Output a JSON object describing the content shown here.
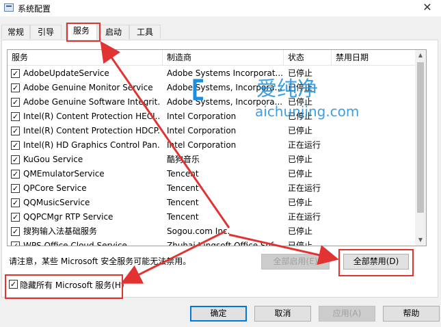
{
  "window": {
    "title": "系统配置",
    "close": "✕"
  },
  "tabs": [
    {
      "label": "常规"
    },
    {
      "label": "引导"
    },
    {
      "label": "服务"
    },
    {
      "label": "启动"
    },
    {
      "label": "工具"
    }
  ],
  "columns": [
    "服务",
    "制造商",
    "状态",
    "禁用日期"
  ],
  "services": [
    {
      "name": "AdobeUpdateService",
      "vendor": "Adobe Systems Incorporat...",
      "status": "已停止"
    },
    {
      "name": "Adobe Genuine Monitor Service",
      "vendor": "Adobe Systems, Incorpora...",
      "status": "已停止"
    },
    {
      "name": "Adobe Genuine Software Integrit...",
      "vendor": "Adobe Systems, Incorpora...",
      "status": "已停止"
    },
    {
      "name": "Intel(R) Content Protection HECI...",
      "vendor": "Intel Corporation",
      "status": "已停止"
    },
    {
      "name": "Intel(R) Content Protection HDCP...",
      "vendor": "Intel Corporation",
      "status": "已停止"
    },
    {
      "name": "Intel(R) HD Graphics Control Pan...",
      "vendor": "Intel Corporation",
      "status": "正在运行"
    },
    {
      "name": "KuGou Service",
      "vendor": "酷狗音乐",
      "status": "已停止"
    },
    {
      "name": "QMEmulatorService",
      "vendor": "Tencent",
      "status": "已停止"
    },
    {
      "name": "QPCore Service",
      "vendor": "Tencent",
      "status": "正在运行"
    },
    {
      "name": "QQMusicService",
      "vendor": "Tencent",
      "status": "已停止"
    },
    {
      "name": "QQPCMgr RTP Service",
      "vendor": "Tencent",
      "status": "正在运行"
    },
    {
      "name": "搜狗输入法基础服务",
      "vendor": "Sogou.com Inc.",
      "status": "已停止"
    },
    {
      "name": "WPS Office Cloud Service",
      "vendor": "Zhuhai Kingsoft Office Sof...",
      "status": "已停止"
    }
  ],
  "notice": "请注意，某些 Microsoft 安全服务可能无法禁用。",
  "buttons": {
    "enable_all": "全部启用(E)",
    "disable_all": "全部禁用(D)",
    "ok": "确定",
    "cancel": "取消",
    "apply": "应用(A)",
    "help": "帮助"
  },
  "hide_ms": {
    "label": "隐藏所有 Microsoft 服务(H)",
    "checked": true
  },
  "watermark": {
    "cn": "爱纯净",
    "url": "aichunjing.com"
  },
  "colors": {
    "annotation": "#e23333",
    "watermark": "#1a8fe0",
    "focus": "#0078d7"
  }
}
